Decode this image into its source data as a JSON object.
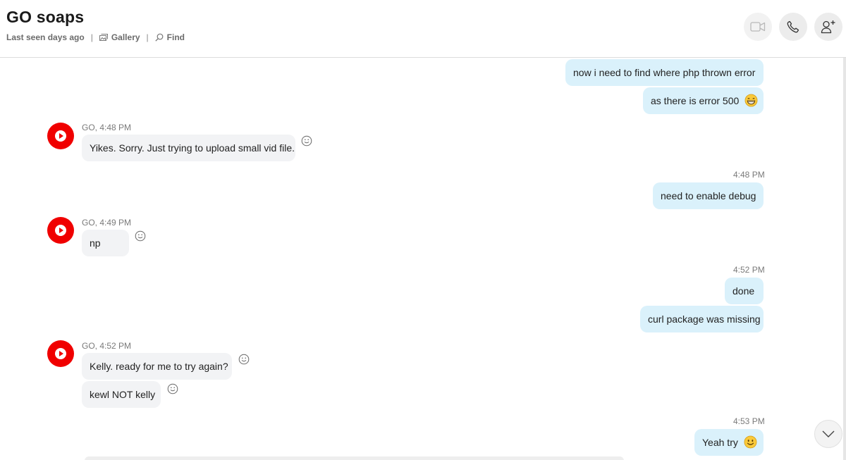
{
  "header": {
    "title": "GO soaps",
    "status": "Last seen days ago",
    "separator": "|",
    "gallery_label": "Gallery",
    "find_label": "Find"
  },
  "icons": {
    "video": "video-camera-icon",
    "call": "phone-icon",
    "add": "add-person-icon",
    "scroll": "chevron-down-icon"
  },
  "colors": {
    "outgoing_bubble": "#daf1fb",
    "incoming_bubble": "#f2f3f5",
    "avatar": "#f00000"
  },
  "messages": {
    "m1": {
      "text": "now i need to find where php thrown error"
    },
    "m2": {
      "text": "as there is error 500",
      "emoji": "grinning-face"
    },
    "m3": {
      "meta": "GO, 4:48 PM",
      "text": "Yikes. Sorry. Just trying to upload small vid file."
    },
    "m4": {
      "meta": "4:48 PM",
      "text": "need to enable debug"
    },
    "m5": {
      "meta": "GO, 4:49 PM",
      "text": "np"
    },
    "m6": {
      "meta": "4:52 PM",
      "text": "done"
    },
    "m7": {
      "text": "curl package was missing"
    },
    "m8": {
      "meta": "GO, 4:52 PM",
      "text": "Kelly. ready for me to try again?"
    },
    "m9": {
      "text": "kewl NOT kelly"
    },
    "m10": {
      "meta": "4:53 PM",
      "text": "Yeah try",
      "emoji": "smiling-face"
    }
  }
}
